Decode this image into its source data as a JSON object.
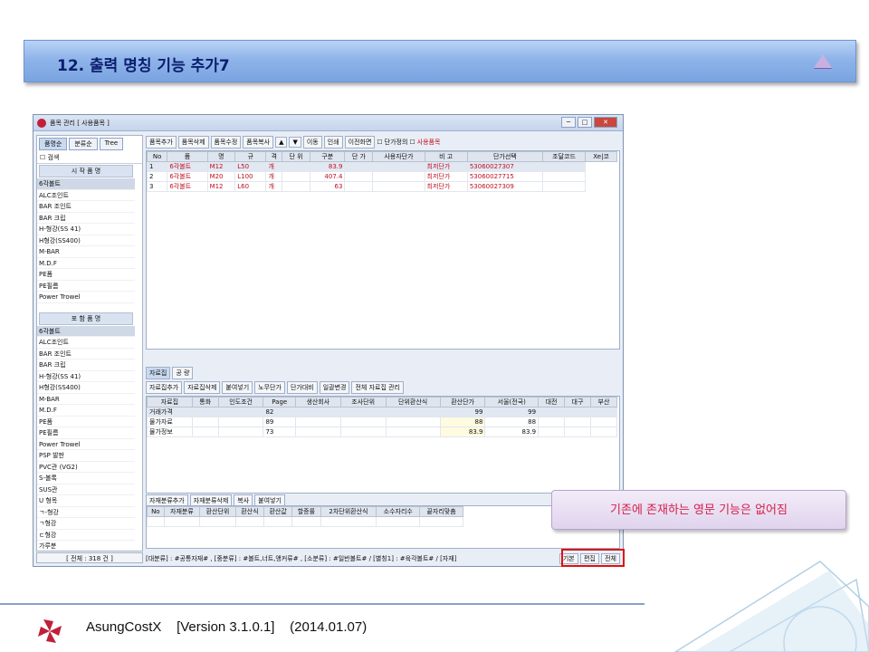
{
  "slide": {
    "title": "12. 출력 명칭 기능 추가7",
    "callout": "기존에 존재하는 영문 기능은 없어짐",
    "footer_app": "AsungCostX",
    "footer_version": "[Version 3.1.0.1]",
    "footer_date": "(2014.01.07)"
  },
  "window": {
    "title": "품목 관리 [ 사용품목 ]"
  },
  "left": {
    "tabs": [
      "품명순",
      "분류순",
      "Tree"
    ],
    "search_label": "검색",
    "head1": "시 작 품 명",
    "items1": [
      "6각볼트",
      "ALC조인트",
      "BAR 조인트",
      "BAR 크립",
      "H-형강(SS 41)",
      "H형강(SS400)",
      "M-BAR",
      "M.D.F",
      "PE폼",
      "PE필름",
      "Power Trowel"
    ],
    "head2": "포 함 품 명",
    "items2": [
      "6각볼트",
      "ALC조인트",
      "BAR 조인트",
      "BAR 크립",
      "H-형강(SS 41)",
      "H형강(SS400)",
      "M-BAR",
      "M.D.F",
      "PE폼",
      "PE필름",
      "Power Trowel",
      "PSP 발판",
      "PVC관 (VG2)",
      "S-볼록",
      "SUS관",
      "U 형목",
      "ㄱ-형강",
      "ㄱ형강",
      "ㄷ형강",
      "가루분"
    ],
    "footer": "[ 전체 : 318 건 ]"
  },
  "toolbar": {
    "buttons": [
      "품목추가",
      "품목삭제",
      "품목수정",
      "품목복사",
      "▲",
      "▼",
      "이동",
      "인쇄",
      "이전화면"
    ],
    "chk1": "단가정의",
    "chk2": "사용품목"
  },
  "grid1": {
    "headers": [
      "No",
      "품",
      "명",
      "규",
      "격",
      "단 위",
      "구분",
      "단 가",
      "사용자단가",
      "비 고",
      "단가선택",
      "조달코드",
      "Xe|코"
    ],
    "rows": [
      [
        "1",
        "6각볼트",
        "M12",
        "L50",
        "개",
        "83.9",
        "최저단가",
        "53060027307"
      ],
      [
        "2",
        "6각볼트",
        "M20",
        "L100",
        "개",
        "407.4",
        "최저단가",
        "53060027715"
      ],
      [
        "3",
        "6각볼트",
        "M12",
        "L60",
        "개",
        "63",
        "최저단가",
        "53060027309"
      ]
    ]
  },
  "tabs2": [
    "자료집",
    "공 량"
  ],
  "toolbar2": [
    "자료집추가",
    "자료집삭제",
    "붙여넣기",
    "노무단가",
    "단가대비",
    "일괄변경",
    "전체 자료집 관리"
  ],
  "grid2": {
    "headers": [
      "자료집",
      "통화",
      "인도조건",
      "Page",
      "생산회사",
      "조사단위",
      "단위환산식",
      "환산단가",
      "서울(전국)",
      "대전",
      "대구",
      "부산"
    ],
    "rows": [
      [
        "거래가격",
        "82",
        "99",
        "99"
      ],
      [
        "물가자료",
        "89",
        "88",
        "88"
      ],
      [
        "물가정보",
        "73",
        "83.9",
        "83.9"
      ]
    ]
  },
  "toolbar3": [
    "자재분류추가",
    "자재분류삭제",
    "복사",
    "붙여넣기"
  ],
  "grid3": {
    "headers": [
      "No",
      "자재분류",
      "환산단위",
      "환산식",
      "환산값",
      "할증률",
      "2차단위환산식",
      "소수자리수",
      "끝자리맞춤"
    ]
  },
  "status": {
    "text": "[대분류] : #공통자재# , [중분류] : #볼트,너트,앵커류# , [소분류] : #일반볼트# / [별칭1] : #육각볼트# / [자재]",
    "btns": [
      "기본",
      "편집",
      "전체"
    ]
  }
}
